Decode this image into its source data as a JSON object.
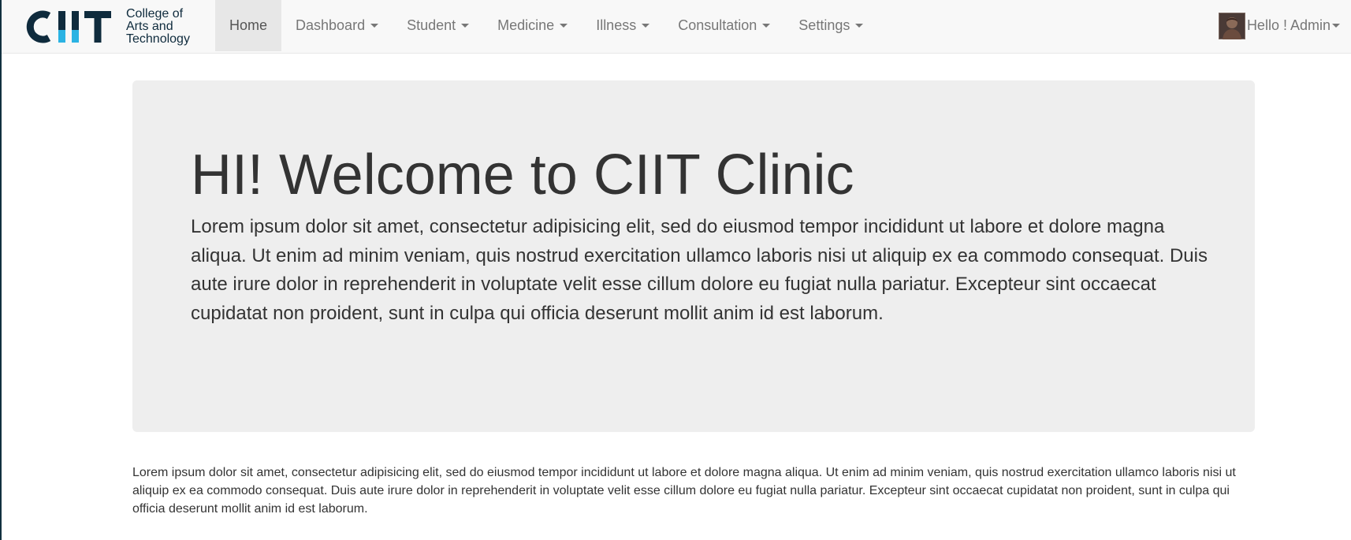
{
  "brand": {
    "logo_letters": "CIIT",
    "line1": "College of",
    "line2": "Arts and",
    "line3": "Technology",
    "colors": {
      "dark": "#0f2b3d",
      "accent": "#2bb3e3"
    }
  },
  "nav": {
    "items": [
      {
        "label": "Home",
        "active": true,
        "dropdown": false
      },
      {
        "label": "Dashboard",
        "active": false,
        "dropdown": true
      },
      {
        "label": "Student",
        "active": false,
        "dropdown": true
      },
      {
        "label": "Medicine",
        "active": false,
        "dropdown": true
      },
      {
        "label": "Illness",
        "active": false,
        "dropdown": true
      },
      {
        "label": "Consultation",
        "active": false,
        "dropdown": true
      },
      {
        "label": "Settings",
        "active": false,
        "dropdown": true
      }
    ]
  },
  "user": {
    "greeting": "Hello ! Admin",
    "avatar_icon": "user-avatar-icon"
  },
  "jumbotron": {
    "title": "HI! Welcome to CIIT Clinic",
    "text": "Lorem ipsum dolor sit amet, consectetur adipisicing elit, sed do eiusmod tempor incididunt ut labore et dolore magna aliqua. Ut enim ad minim veniam, quis nostrud exercitation ullamco laboris nisi ut aliquip ex ea commodo consequat. Duis aute irure dolor in reprehenderit in voluptate velit esse cillum dolore eu fugiat nulla pariatur. Excepteur sint occaecat cupidatat non proident, sunt in culpa qui officia deserunt mollit anim id est laborum."
  },
  "body_text": "Lorem ipsum dolor sit amet, consectetur adipisicing elit, sed do eiusmod tempor incididunt ut labore et dolore magna aliqua. Ut enim ad minim veniam, quis nostrud exercitation ullamco laboris nisi ut aliquip ex ea commodo consequat. Duis aute irure dolor in reprehenderit in voluptate velit esse cillum dolore eu fugiat nulla pariatur. Excepteur sint occaecat cupidatat non proident, sunt in culpa qui officia deserunt mollit anim id est laborum."
}
